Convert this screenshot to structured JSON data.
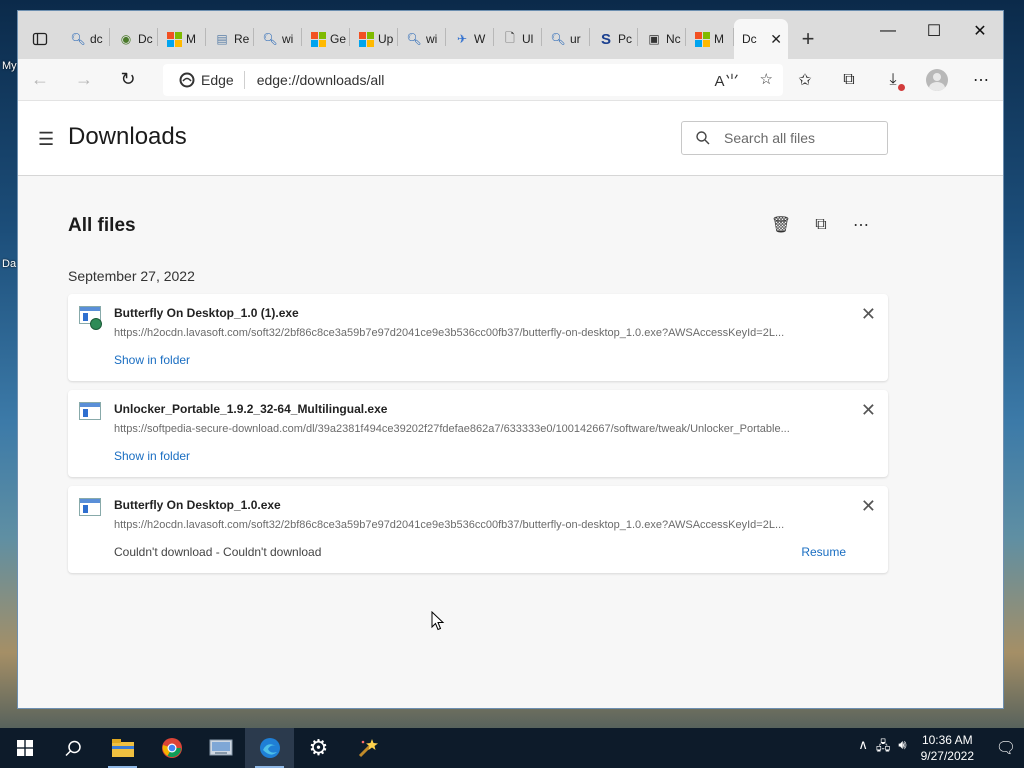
{
  "desktop": {
    "fragments": [
      "My",
      "Da"
    ]
  },
  "tabs": [
    {
      "icon": "search-icon",
      "title": "dc"
    },
    {
      "icon": "owl-icon",
      "title": "Dc"
    },
    {
      "icon": "ms-logo-icon",
      "title": "M"
    },
    {
      "icon": "document-icon",
      "title": "Re"
    },
    {
      "icon": "search-icon",
      "title": "wi"
    },
    {
      "icon": "ms-logo-icon",
      "title": "Ge"
    },
    {
      "icon": "ms-logo-icon",
      "title": "Up"
    },
    {
      "icon": "search-icon",
      "title": "wi"
    },
    {
      "icon": "wing-icon",
      "title": "W"
    },
    {
      "icon": "page-icon",
      "title": "Ul"
    },
    {
      "icon": "search-icon",
      "title": "ur"
    },
    {
      "icon": "s-logo-icon",
      "title": "Pc"
    },
    {
      "icon": "calendar-icon",
      "title": "Nc"
    },
    {
      "icon": "ms-logo-icon",
      "title": "M"
    }
  ],
  "active_tab": {
    "title": "Dc"
  },
  "address_bar": {
    "chip_label": "Edge",
    "url": "edge://downloads/all"
  },
  "page": {
    "title": "Downloads",
    "search_placeholder": "Search all files",
    "section_title": "All files",
    "date_group": "September 27, 2022"
  },
  "downloads": [
    {
      "name": "Butterfly On Desktop_1.0 (1).exe",
      "url": "https://h2ocdn.lavasoft.com/soft32/2bf86c8ce3a59b7e97d2041ce9e3b536cc00fb37/butterfly-on-desktop_1.0.exe?AWSAccessKeyId=2L...",
      "link": "Show in folder",
      "icon": "setup-exe-icon"
    },
    {
      "name": "Unlocker_Portable_1.9.2_32-64_Multilingual.exe",
      "url": "https://softpedia-secure-download.com/dl/39a2381f494ce39202f27fdefae862a7/633333e0/100142667/software/tweak/Unlocker_Portable...",
      "link": "Show in folder",
      "icon": "exe-icon"
    },
    {
      "name": "Butterfly On Desktop_1.0.exe",
      "url": "https://h2ocdn.lavasoft.com/soft32/2bf86c8ce3a59b7e97d2041ce9e3b536cc00fb37/butterfly-on-desktop_1.0.exe?AWSAccessKeyId=2L...",
      "status": "Couldn't download - Couldn't download",
      "action": "Resume",
      "icon": "exe-icon"
    }
  ],
  "taskbar": {
    "apps": [
      "start-icon",
      "search-icon",
      "file-explorer-icon",
      "chrome-icon",
      "control-panel-icon",
      "edge-icon",
      "settings-icon",
      "wand-icon"
    ]
  },
  "clock": {
    "time": "10:36 AM",
    "date": "9/27/2022"
  },
  "colors": {
    "link": "#1a6ec2",
    "taskbar": "#0d1b2a"
  }
}
